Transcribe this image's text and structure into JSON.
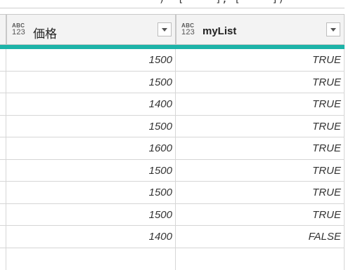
{
  "formula_bar": {
    "text": ")  [     ], [     ])"
  },
  "columns": [
    {
      "name": "価格",
      "type_icon": "abc-123-type-icon"
    },
    {
      "name": "myList",
      "type_icon": "abc-123-type-icon"
    }
  ],
  "type_icon_text": {
    "top": "ABC",
    "bottom": "123"
  },
  "rows": [
    {
      "price": "1500",
      "mylist": "TRUE"
    },
    {
      "price": "1500",
      "mylist": "TRUE"
    },
    {
      "price": "1400",
      "mylist": "TRUE"
    },
    {
      "price": "1500",
      "mylist": "TRUE"
    },
    {
      "price": "1600",
      "mylist": "TRUE"
    },
    {
      "price": "1500",
      "mylist": "TRUE"
    },
    {
      "price": "1500",
      "mylist": "TRUE"
    },
    {
      "price": "1500",
      "mylist": "TRUE"
    },
    {
      "price": "1400",
      "mylist": "FALSE"
    }
  ],
  "colors": {
    "accent": "#1db3a8",
    "header_bg": "#f3f3f3"
  }
}
